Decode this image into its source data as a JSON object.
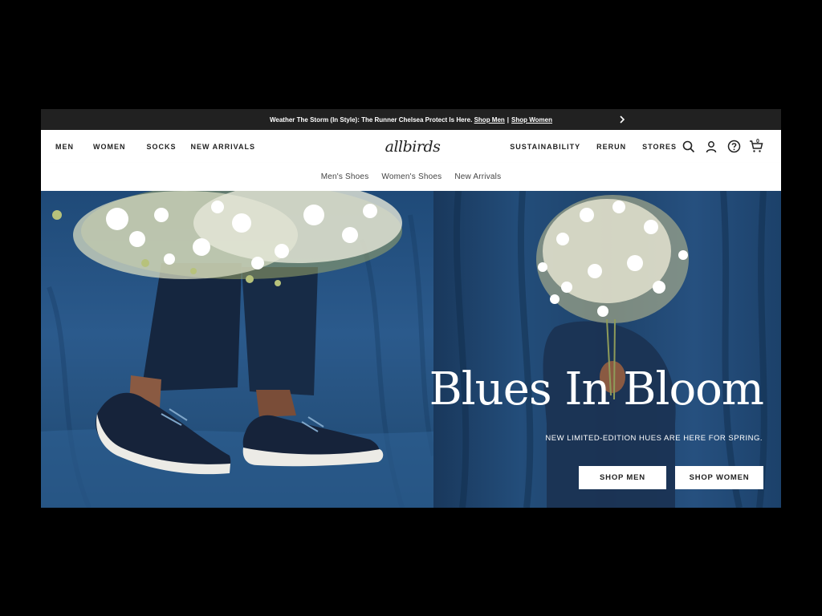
{
  "announcement": {
    "text": "Weather The Storm (In Style): The Runner Chelsea Protect Is Here.",
    "shop_men": "Shop Men",
    "separator": "|",
    "shop_women": "Shop Women",
    "arrow_icon": "chevron-right-icon"
  },
  "header": {
    "logo": "allbirds",
    "nav_left": [
      "MEN",
      "WOMEN",
      "SOCKS",
      "NEW ARRIVALS"
    ],
    "nav_right": [
      "SUSTAINABILITY",
      "RERUN",
      "STORES"
    ],
    "icons": [
      "search-icon",
      "account-icon",
      "help-icon",
      "cart-icon"
    ],
    "cart_count": "0"
  },
  "subnav": [
    "Men's Shoes",
    "Women's Shoes",
    "New Arrivals"
  ],
  "hero": {
    "title": "Blues In Bloom",
    "subtitle": "NEW LIMITED-EDITION HUES ARE HERE FOR SPRING.",
    "cta_men": "SHOP MEN",
    "cta_women": "SHOP WOMEN"
  },
  "colors": {
    "announcement_bg": "#212121",
    "hero_blue": "#234d7a",
    "text_dark": "#212121"
  }
}
